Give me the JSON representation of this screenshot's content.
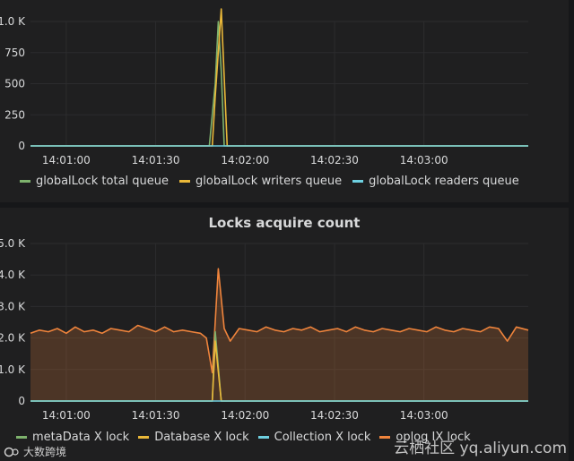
{
  "panels": {
    "queue": {
      "legend": [
        {
          "label": "globalLock total queue",
          "color": "#7eb26d"
        },
        {
          "label": "globalLock writers queue",
          "color": "#eab839"
        },
        {
          "label": "globalLock readers queue",
          "color": "#6ed0e0"
        }
      ]
    },
    "locks": {
      "title": "Locks acquire count",
      "legend": [
        {
          "label": "metaData X lock",
          "color": "#7eb26d"
        },
        {
          "label": "Database X lock",
          "color": "#eab839"
        },
        {
          "label": "Collection X lock",
          "color": "#6ed0e0"
        },
        {
          "label": "oplog IX lock",
          "color": "#ef843c"
        }
      ]
    }
  },
  "watermark": {
    "left_brand": "大数跨境",
    "right_brand": "云栖社区 yq.aliyun.com"
  },
  "chart_data": [
    {
      "type": "line",
      "title": "",
      "ylim": [
        0,
        1000
      ],
      "y_ticks": [
        "1.0 K",
        "750",
        "500",
        "250",
        "0"
      ],
      "x_ticks": [
        "14:01:00",
        "14:01:30",
        "14:02:00",
        "14:02:30",
        "14:03:00"
      ],
      "x_range": [
        "14:00:48",
        "14:03:35"
      ],
      "legend_placement": "bottom",
      "grid": true,
      "series": [
        {
          "name": "globalLock total queue",
          "color": "#7eb26d",
          "points": [
            [
              "14:00:48",
              0
            ],
            [
              "14:01:48",
              0
            ],
            [
              "14:01:50",
              500
            ],
            [
              "14:01:51",
              1000
            ],
            [
              "14:01:52",
              600
            ],
            [
              "14:01:53",
              0
            ],
            [
              "14:03:35",
              0
            ]
          ]
        },
        {
          "name": "globalLock writers queue",
          "color": "#eab839",
          "points": [
            [
              "14:00:48",
              0
            ],
            [
              "14:01:49",
              0
            ],
            [
              "14:01:50",
              400
            ],
            [
              "14:01:52",
              1100
            ],
            [
              "14:01:54",
              0
            ],
            [
              "14:03:35",
              0
            ]
          ]
        },
        {
          "name": "globalLock readers queue",
          "color": "#6ed0e0",
          "points": [
            [
              "14:00:48",
              0
            ],
            [
              "14:03:35",
              0
            ]
          ]
        }
      ]
    },
    {
      "type": "line",
      "title": "Locks acquire count",
      "ylim": [
        0,
        5000
      ],
      "y_ticks": [
        "5.0 K",
        "4.0 K",
        "3.0 K",
        "2.0 K",
        "1.0 K",
        "0"
      ],
      "x_ticks": [
        "14:01:00",
        "14:01:30",
        "14:02:00",
        "14:02:30",
        "14:03:00"
      ],
      "x_range": [
        "14:00:48",
        "14:03:35"
      ],
      "legend_placement": "bottom",
      "grid": true,
      "series": [
        {
          "name": "metaData X lock",
          "color": "#7eb26d",
          "points": [
            [
              "14:00:48",
              0
            ],
            [
              "14:01:49",
              0
            ],
            [
              "14:01:50",
              2200
            ],
            [
              "14:01:52",
              0
            ],
            [
              "14:03:35",
              0
            ]
          ]
        },
        {
          "name": "Database X lock",
          "color": "#eab839",
          "points": [
            [
              "14:00:48",
              0
            ],
            [
              "14:01:49",
              0
            ],
            [
              "14:01:50",
              1900
            ],
            [
              "14:01:52",
              0
            ],
            [
              "14:03:35",
              0
            ]
          ]
        },
        {
          "name": "Collection X lock",
          "color": "#6ed0e0",
          "points": [
            [
              "14:00:48",
              0
            ],
            [
              "14:03:35",
              0
            ]
          ]
        },
        {
          "name": "oplog IX lock",
          "color": "#ef843c",
          "fill": true,
          "points": [
            [
              "14:00:48",
              2150
            ],
            [
              "14:00:51",
              2250
            ],
            [
              "14:00:54",
              2200
            ],
            [
              "14:00:57",
              2300
            ],
            [
              "14:01:00",
              2150
            ],
            [
              "14:01:03",
              2350
            ],
            [
              "14:01:06",
              2200
            ],
            [
              "14:01:09",
              2250
            ],
            [
              "14:01:12",
              2150
            ],
            [
              "14:01:15",
              2300
            ],
            [
              "14:01:18",
              2250
            ],
            [
              "14:01:21",
              2200
            ],
            [
              "14:01:24",
              2400
            ],
            [
              "14:01:27",
              2300
            ],
            [
              "14:01:30",
              2200
            ],
            [
              "14:01:33",
              2350
            ],
            [
              "14:01:36",
              2200
            ],
            [
              "14:01:39",
              2250
            ],
            [
              "14:01:42",
              2200
            ],
            [
              "14:01:45",
              2150
            ],
            [
              "14:01:47",
              2000
            ],
            [
              "14:01:49",
              900
            ],
            [
              "14:01:51",
              4200
            ],
            [
              "14:01:53",
              2300
            ],
            [
              "14:01:55",
              1900
            ],
            [
              "14:01:58",
              2300
            ],
            [
              "14:02:01",
              2250
            ],
            [
              "14:02:04",
              2200
            ],
            [
              "14:02:07",
              2350
            ],
            [
              "14:02:10",
              2250
            ],
            [
              "14:02:13",
              2200
            ],
            [
              "14:02:16",
              2300
            ],
            [
              "14:02:19",
              2250
            ],
            [
              "14:02:22",
              2350
            ],
            [
              "14:02:25",
              2200
            ],
            [
              "14:02:28",
              2250
            ],
            [
              "14:02:31",
              2300
            ],
            [
              "14:02:34",
              2200
            ],
            [
              "14:02:37",
              2350
            ],
            [
              "14:02:40",
              2250
            ],
            [
              "14:02:43",
              2200
            ],
            [
              "14:02:46",
              2300
            ],
            [
              "14:02:49",
              2250
            ],
            [
              "14:02:52",
              2200
            ],
            [
              "14:02:55",
              2300
            ],
            [
              "14:02:58",
              2250
            ],
            [
              "14:03:01",
              2200
            ],
            [
              "14:03:04",
              2350
            ],
            [
              "14:03:07",
              2250
            ],
            [
              "14:03:10",
              2200
            ],
            [
              "14:03:13",
              2300
            ],
            [
              "14:03:16",
              2250
            ],
            [
              "14:03:19",
              2200
            ],
            [
              "14:03:22",
              2350
            ],
            [
              "14:03:25",
              2300
            ],
            [
              "14:03:28",
              1900
            ],
            [
              "14:03:31",
              2350
            ],
            [
              "14:03:35",
              2250
            ]
          ]
        }
      ]
    }
  ]
}
